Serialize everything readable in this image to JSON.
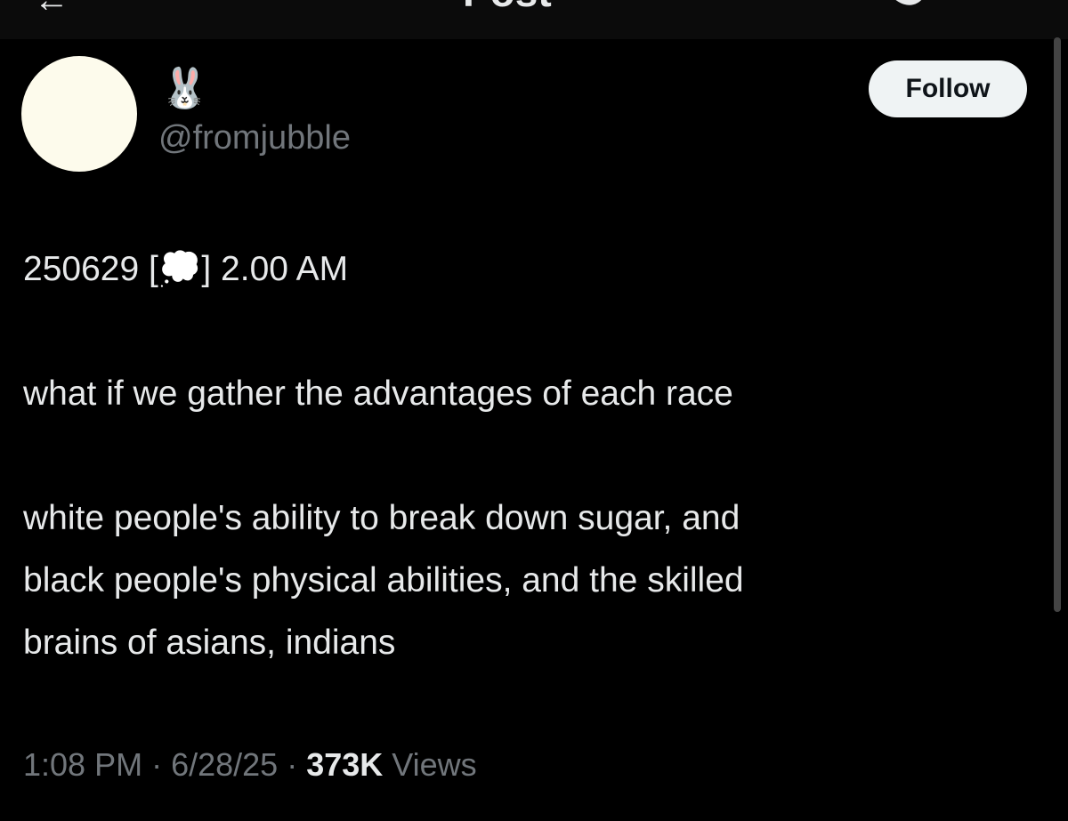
{
  "header": {
    "back_icon": "arrow-left-icon",
    "title": "Post"
  },
  "post": {
    "avatar_color": "#fdfbec",
    "display_name": "🐰",
    "handle": "@fromjubble",
    "follow_label": "Follow",
    "line1_prefix": "250629 [",
    "line1_emoji": "💭",
    "line1_suffix": "] 2.00 AM",
    "line2": "what if we gather the advantages of each race",
    "line3": "white people's ability to break down sugar, and",
    "line4": "black people's physical abilities, and the skilled",
    "line5": "brains of asians, indians",
    "time": "1:08 PM",
    "sep": " · ",
    "date": "6/28/25",
    "views_count": "373K",
    "views_label": " Views"
  },
  "colors": {
    "background": "#000000",
    "text": "#e7e9ea",
    "muted": "#71767b",
    "button": "#eff3f4"
  }
}
